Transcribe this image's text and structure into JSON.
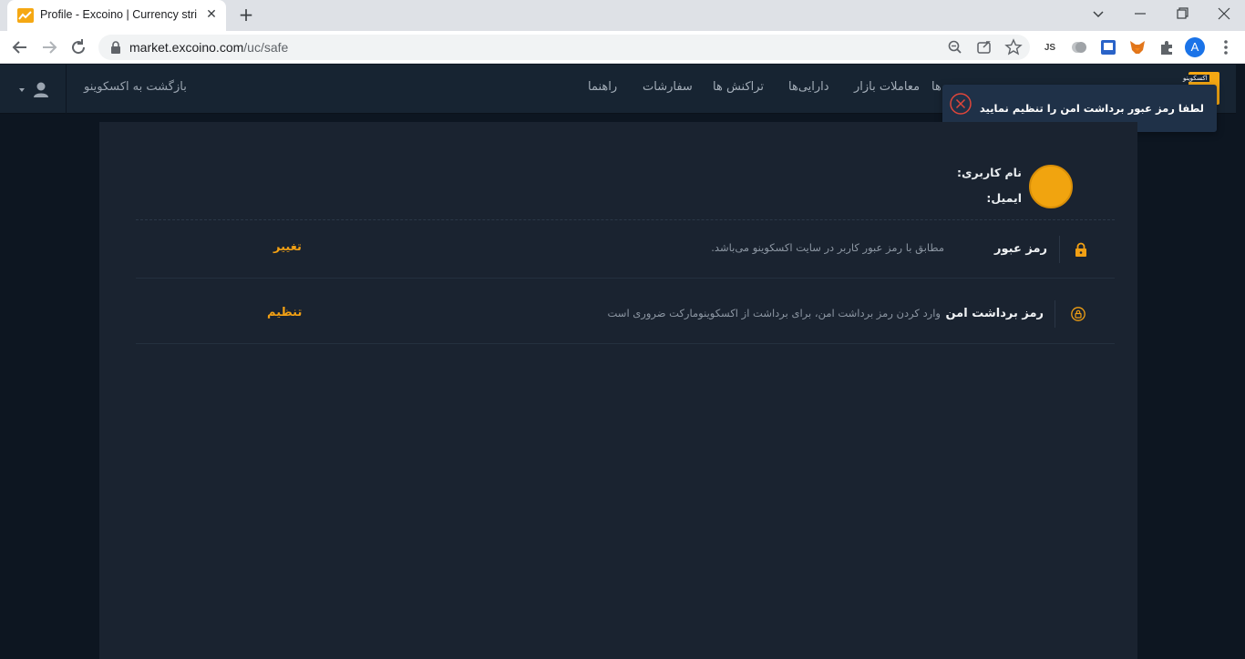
{
  "browser": {
    "tab_title": "Profile - Excoino | Currency strict",
    "tab_close": "✕",
    "new_tab": "+",
    "url_host": "market.excoino.com",
    "url_path": "/uc/safe",
    "profile_initial": "A",
    "ext_js_label": "JS"
  },
  "header": {
    "back_link": "بازگشت به اکسکوینو",
    "nav": [
      {
        "label": "راهنما"
      },
      {
        "label": "سفارشات"
      },
      {
        "label": "تراکنش ها"
      },
      {
        "label": "دارایی‌ها"
      },
      {
        "label": "معاملات بازار"
      },
      {
        "label": "ها"
      }
    ],
    "logo_text": "اکسکوینو"
  },
  "toast": {
    "message": "لطفا رمز عبور برداشت امن را تنظیم نمایید"
  },
  "profile": {
    "username_label": "نام کاربری:",
    "email_label": "ایمیل:"
  },
  "security": {
    "rows": [
      {
        "title": "رمز عبور",
        "description": "مطابق با رمز عبور کاربر در سایت اکسکوینو می‌باشد.",
        "action": "تغییر"
      },
      {
        "title": "رمز برداشت امن",
        "description": "وارد کردن رمز برداشت امن، برای برداشت از اکسکوینومارکت ضروری است",
        "action": "تنظیم"
      }
    ]
  },
  "colors": {
    "accent": "#f2a014",
    "header_bg": "#172432",
    "panel_bg": "#1a2330",
    "toast_close": "#e0463a"
  }
}
